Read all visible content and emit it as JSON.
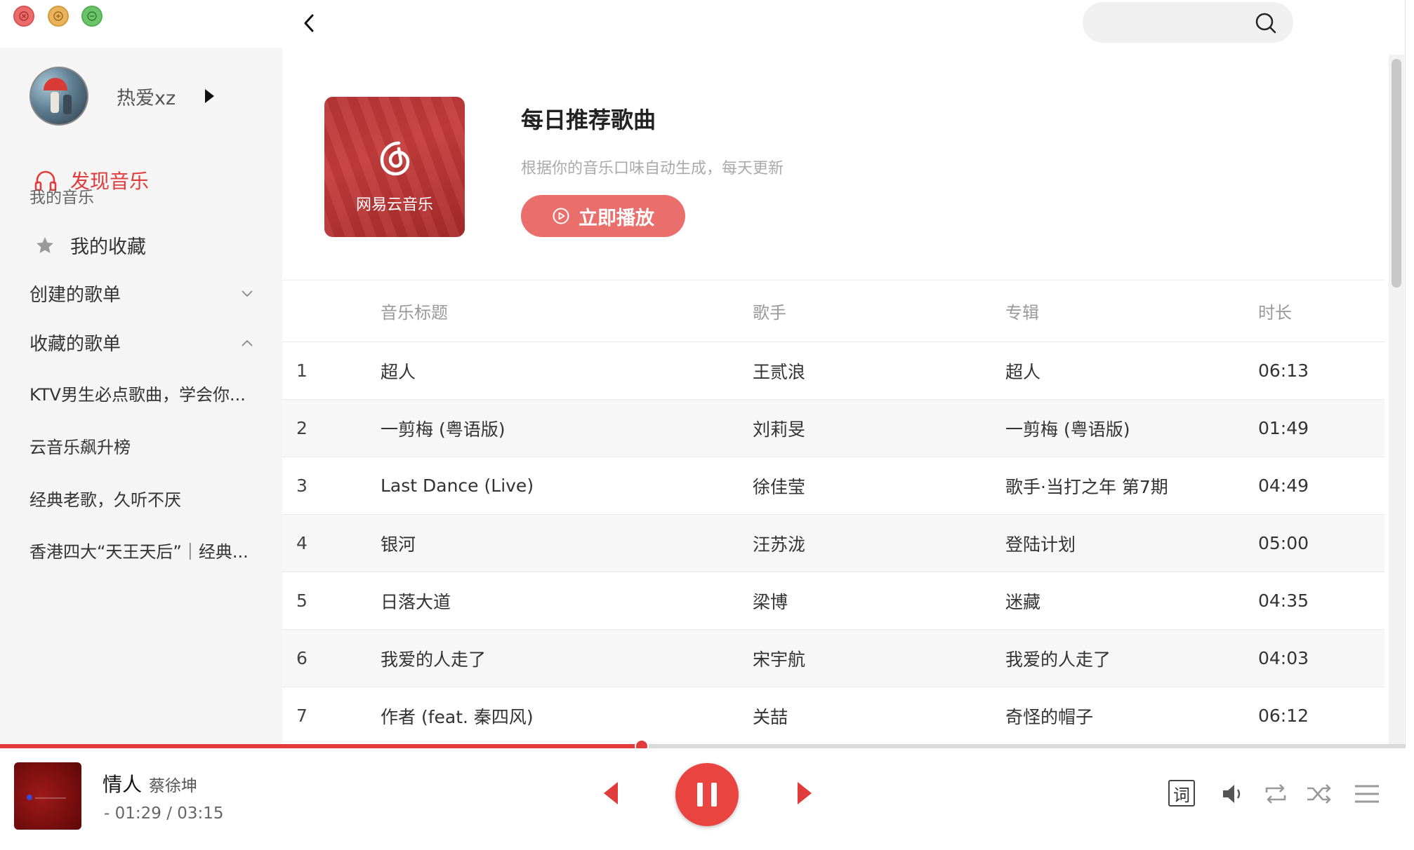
{
  "window": {
    "controls": [
      "close",
      "minimize",
      "maximize"
    ]
  },
  "sidebar": {
    "username": "热爱xz",
    "discover_label": "发现音乐",
    "my_music_label": "我的音乐",
    "favorites_label": "我的收藏",
    "created_playlists_label": "创建的歌单",
    "collected_playlists_label": "收藏的歌单",
    "collected_playlists": [
      "KTV男生必点歌曲，学会你...",
      "云音乐飙升榜",
      "经典老歌，久听不厌",
      "香港四大“天王天后”｜经典..."
    ]
  },
  "playlist": {
    "cover_brand": "网易云音乐",
    "title": "每日推荐歌曲",
    "description": "根据你的音乐口味自动生成，每天更新",
    "play_label": "立即播放"
  },
  "table": {
    "headers": [
      "音乐标题",
      "歌手",
      "专辑",
      "时长"
    ],
    "rows": [
      {
        "num": "1",
        "title": "超人",
        "artist": "王贰浪",
        "album": "超人",
        "duration": "06:13"
      },
      {
        "num": "2",
        "title": "一剪梅 (粤语版)",
        "artist": "刘莉旻",
        "album": "一剪梅 (粤语版)",
        "duration": "01:49"
      },
      {
        "num": "3",
        "title": "Last Dance (Live)",
        "artist": "徐佳莹",
        "album": "歌手·当打之年 第7期",
        "duration": "04:49"
      },
      {
        "num": "4",
        "title": "银河",
        "artist": "汪苏泷",
        "album": "登陆计划",
        "duration": "05:00"
      },
      {
        "num": "5",
        "title": "日落大道",
        "artist": "梁博",
        "album": "迷藏",
        "duration": "04:35"
      },
      {
        "num": "6",
        "title": "我爱的人走了",
        "artist": "宋宇航",
        "album": "我爱的人走了",
        "duration": "04:03"
      },
      {
        "num": "7",
        "title": "作者 (feat. 秦四风)",
        "artist": "关喆",
        "album": "奇怪的帽子",
        "duration": "06:12"
      }
    ]
  },
  "player": {
    "song": "情人",
    "artist": "蔡徐坤",
    "time": "- 01:29 / 03:15",
    "progress_fraction": 0.4564,
    "lyric_label": "词",
    "accent": "#e23b3b"
  },
  "icons": [
    "headphones-icon",
    "star-icon",
    "chevron-down-icon",
    "chevron-up-icon",
    "back-icon",
    "search-icon",
    "play-circle-icon",
    "prev-icon",
    "pause-icon",
    "next-icon",
    "volume-icon",
    "repeat-icon",
    "shuffle-icon",
    "menu-icon"
  ]
}
